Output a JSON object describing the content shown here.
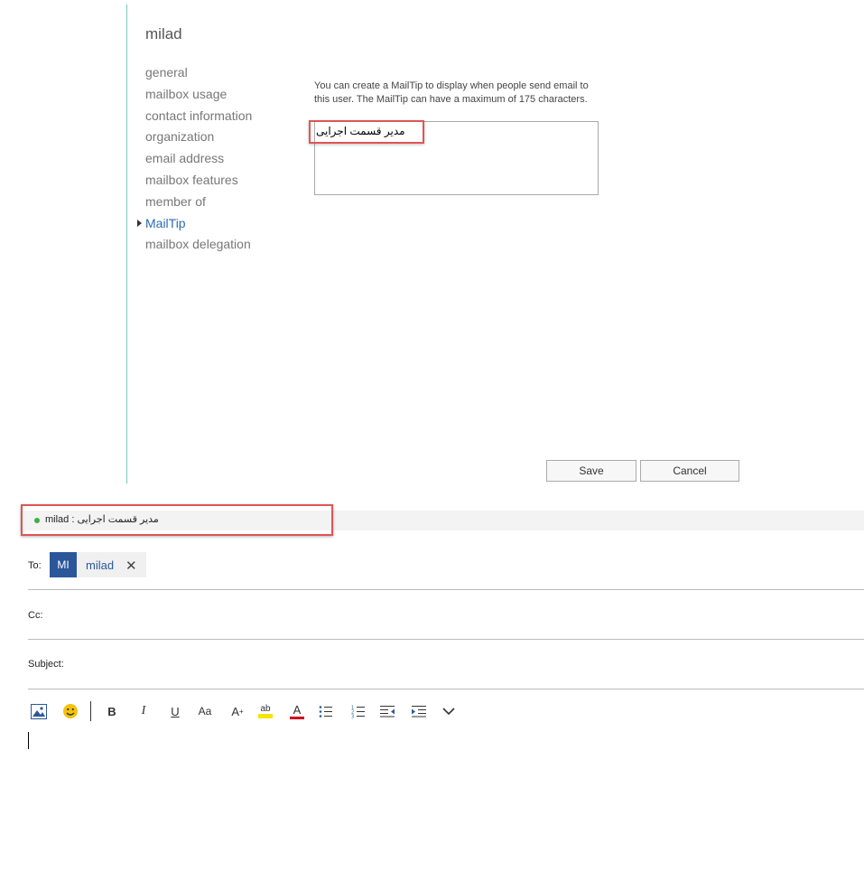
{
  "panel": {
    "user_name": "milad",
    "nav_items": [
      {
        "label": "general"
      },
      {
        "label": "mailbox usage"
      },
      {
        "label": "contact information"
      },
      {
        "label": "organization"
      },
      {
        "label": "email address"
      },
      {
        "label": "mailbox features"
      },
      {
        "label": "member of"
      },
      {
        "label": "MailTip",
        "active": true
      },
      {
        "label": "mailbox delegation"
      }
    ],
    "mailtip_description": "You can create a MailTip to display when people send email to this user. The MailTip can have a maximum of 175 characters.",
    "mailtip_value": "مدیر قسمت اجرایی",
    "save_label": "Save",
    "cancel_label": "Cancel"
  },
  "compose": {
    "mailtip_bar_text": "milad : مدیر قسمت اجرایی",
    "to_label": "To:",
    "recipient_initials": "MI",
    "recipient_name": "milad",
    "cc_label": "Cc:",
    "subject_label": "Subject:",
    "toolbar": {
      "bold": "B",
      "italic": "I",
      "underline": "U",
      "font_size": "Aa",
      "grow_font": "A",
      "highlight": "ab",
      "font_color": "A",
      "icons": [
        "image-icon",
        "emoji-icon",
        "bold-icon",
        "italic-icon",
        "underline-icon",
        "font-size-icon",
        "grow-font-icon",
        "highlight-icon",
        "font-color-icon",
        "bullets-icon",
        "numbering-icon",
        "decrease-indent-icon",
        "increase-indent-icon",
        "chevron-down-icon"
      ]
    }
  },
  "colors": {
    "accent": "#2b579a",
    "link": "#2b6cb0",
    "highlight_frame": "#e05555",
    "presence_green": "#3cb043",
    "divider_teal": "#7fc8c0"
  }
}
